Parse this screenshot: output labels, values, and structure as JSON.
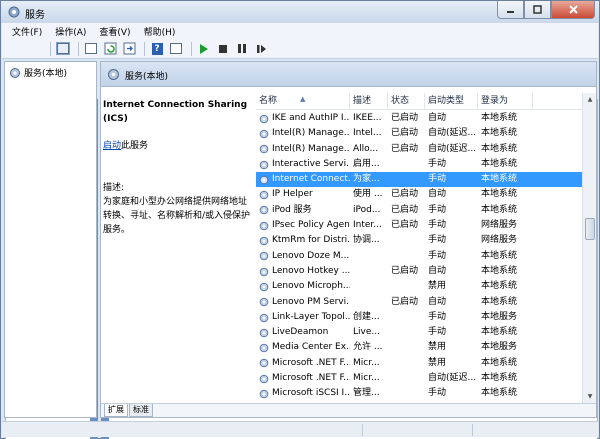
{
  "window": {
    "title": "服务"
  },
  "menu": [
    "文件(F)",
    "操作(A)",
    "查看(V)",
    "帮助(H)"
  ],
  "tree": {
    "root_label": "服务(本地)"
  },
  "right_header": {
    "title": "服务(本地)"
  },
  "description": {
    "service_name": "Internet Connection Sharing (ICS)",
    "start_link": "启动",
    "start_suffix": "此服务",
    "label": "描述:",
    "text": "为家庭和小型办公网络提供网络地址转换、寻址、名称解析和/或入侵保护服务。"
  },
  "table": {
    "columns": [
      "名称",
      "描述",
      "状态",
      "启动类型",
      "登录为"
    ],
    "rows": [
      {
        "name": "IKE and AuthIP I...",
        "desc": "IKEE...",
        "status": "已启动",
        "startup": "自动",
        "logon": "本地系统",
        "selected": false
      },
      {
        "name": "Intel(R) Manage...",
        "desc": "Intel...",
        "status": "已启动",
        "startup": "自动(延迟...",
        "logon": "本地系统",
        "selected": false
      },
      {
        "name": "Intel(R) Manage...",
        "desc": "Allo...",
        "status": "已启动",
        "startup": "自动(延迟...",
        "logon": "本地系统",
        "selected": false
      },
      {
        "name": "Interactive Servi...",
        "desc": "启用...",
        "status": "",
        "startup": "手动",
        "logon": "本地系统",
        "selected": false
      },
      {
        "name": "Internet Connect...",
        "desc": "为家...",
        "status": "",
        "startup": "手动",
        "logon": "本地系统",
        "selected": true
      },
      {
        "name": "IP Helper",
        "desc": "使用 ...",
        "status": "已启动",
        "startup": "自动",
        "logon": "本地系统",
        "selected": false
      },
      {
        "name": "iPod 服务",
        "desc": "iPod...",
        "status": "已启动",
        "startup": "手动",
        "logon": "本地系统",
        "selected": false
      },
      {
        "name": "IPsec Policy Agent",
        "desc": "Inter...",
        "status": "已启动",
        "startup": "手动",
        "logon": "网络服务",
        "selected": false
      },
      {
        "name": "KtmRm for Distri...",
        "desc": "协调...",
        "status": "",
        "startup": "手动",
        "logon": "网络服务",
        "selected": false
      },
      {
        "name": "Lenovo Doze M...",
        "desc": "",
        "status": "",
        "startup": "手动",
        "logon": "本地系统",
        "selected": false
      },
      {
        "name": "Lenovo Hotkey ...",
        "desc": "",
        "status": "已启动",
        "startup": "自动",
        "logon": "本地系统",
        "selected": false
      },
      {
        "name": "Lenovo Microph...",
        "desc": "",
        "status": "",
        "startup": "禁用",
        "logon": "本地系统",
        "selected": false
      },
      {
        "name": "Lenovo PM Servi...",
        "desc": "",
        "status": "已启动",
        "startup": "自动",
        "logon": "本地系统",
        "selected": false
      },
      {
        "name": "Link-Layer Topol...",
        "desc": "创建...",
        "status": "",
        "startup": "手动",
        "logon": "本地服务",
        "selected": false
      },
      {
        "name": "LiveDeamon",
        "desc": "Live...",
        "status": "",
        "startup": "手动",
        "logon": "本地系统",
        "selected": false
      },
      {
        "name": "Media Center Ex...",
        "desc": "允许 ...",
        "status": "",
        "startup": "禁用",
        "logon": "本地服务",
        "selected": false
      },
      {
        "name": "Microsoft .NET F...",
        "desc": "Micr...",
        "status": "",
        "startup": "禁用",
        "logon": "本地系统",
        "selected": false
      },
      {
        "name": "Microsoft .NET F...",
        "desc": "Micr...",
        "status": "",
        "startup": "自动(延迟...",
        "logon": "本地系统",
        "selected": false
      },
      {
        "name": "Microsoft iSCSI I...",
        "desc": "管理...",
        "status": "",
        "startup": "手动",
        "logon": "本地系统",
        "selected": false
      }
    ]
  },
  "tabs": [
    "扩展",
    "标准"
  ]
}
